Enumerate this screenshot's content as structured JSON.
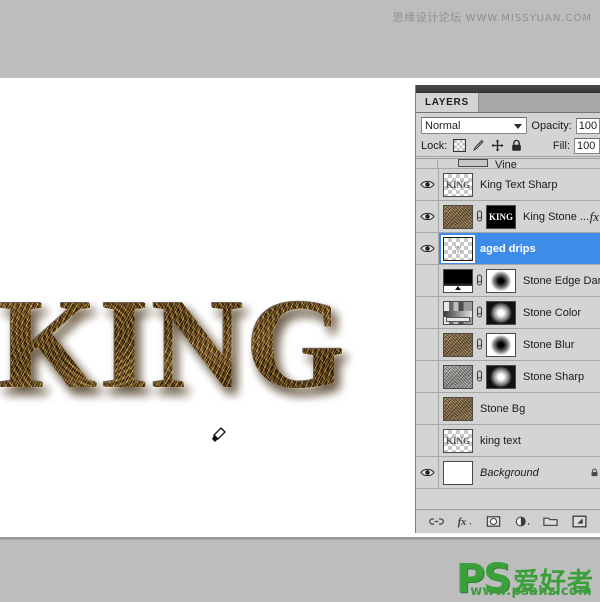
{
  "watermark": {
    "cn": "思缘设计论坛",
    "en": "WWW.MISSYUAN.COM"
  },
  "canvas": {
    "artwork_text": "KING",
    "cursor_icon": "brush-cursor-icon"
  },
  "panel": {
    "tab_label": "LAYERS",
    "blend_mode": "Normal",
    "opacity_label": "Opacity:",
    "opacity_value": "100",
    "fill_label": "Fill:",
    "fill_value": "100",
    "lock_label": "Lock:",
    "lock_icons": [
      "lock-transparency-icon",
      "lock-image-icon",
      "lock-position-icon",
      "lock-all-icon"
    ],
    "toolbar_icons": [
      "link-layers-icon",
      "layer-style-fx-icon",
      "add-mask-icon",
      "adjustment-layer-icon",
      "new-group-icon",
      "new-layer-icon"
    ]
  },
  "layers": [
    {
      "name": "Vine",
      "visible": false,
      "selected": false,
      "partial": true,
      "thumb": "partial"
    },
    {
      "name": "King Text Sharp",
      "visible": true,
      "selected": false,
      "thumb": "checker-king",
      "has_mask": false,
      "has_fx": false
    },
    {
      "name": "King Stone ...",
      "visible": true,
      "selected": false,
      "thumb": "stone",
      "has_mask": true,
      "mask": "king-mask",
      "has_fx": true,
      "fx_label": "fx"
    },
    {
      "name": "aged drips",
      "visible": true,
      "selected": true,
      "thumb": "checker-drips",
      "has_mask": false,
      "has_fx": false
    },
    {
      "name": "Stone Edge Dar",
      "visible": false,
      "selected": false,
      "thumb": "black-grad",
      "has_mask": true,
      "mask": "blob-dark",
      "has_fx": false
    },
    {
      "name": "Stone Color",
      "visible": false,
      "selected": false,
      "thumb": "color-grad",
      "has_mask": true,
      "mask": "blob-light",
      "has_fx": false
    },
    {
      "name": "Stone Blur",
      "visible": false,
      "selected": false,
      "thumb": "stone",
      "has_mask": true,
      "mask": "blob-dark",
      "has_fx": false
    },
    {
      "name": "Stone Sharp",
      "visible": false,
      "selected": false,
      "thumb": "stone-gray",
      "has_mask": true,
      "mask": "blob-light",
      "has_fx": false
    },
    {
      "name": "Stone Bg",
      "visible": false,
      "selected": false,
      "thumb": "stone",
      "has_mask": false,
      "has_fx": false
    },
    {
      "name": "king text",
      "visible": false,
      "selected": false,
      "thumb": "checker-king",
      "has_mask": false,
      "has_fx": false
    },
    {
      "name": "Background",
      "visible": true,
      "selected": false,
      "italic": true,
      "thumb": "plain-white",
      "has_mask": false,
      "has_fx": false
    }
  ],
  "branding": {
    "ps_mark": "PS",
    "ps_cn": "爱好者",
    "url": "www.psahz.com"
  },
  "colors": {
    "desktop_gray": "#bdbdbd",
    "panel_gray": "#d4d4d4",
    "selection_blue": "#3d8ce8",
    "brand_green": "#3aa03a"
  }
}
